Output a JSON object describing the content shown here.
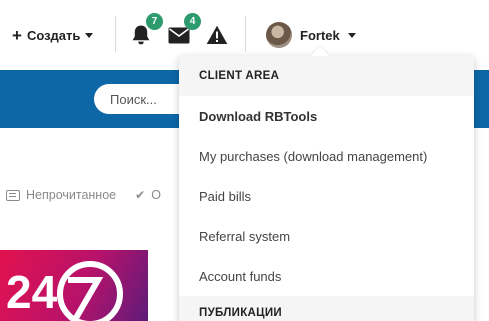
{
  "header": {
    "create_label": "Создать",
    "notifications_badge": "7",
    "messages_badge": "4",
    "user_name": "Fortek"
  },
  "search": {
    "placeholder": "Поиск..."
  },
  "subnav": {
    "unread_label": "Непрочитанное",
    "partial_label": "О"
  },
  "thumbnail": {
    "text": "24·7"
  },
  "dropdown": {
    "section_title": "CLIENT AREA",
    "items": [
      "Download RBTools",
      "My purchases (download management)",
      "Paid bills",
      "Referral system",
      "Account funds"
    ],
    "section2_title": "ПУБЛИКАЦИИ"
  },
  "colors": {
    "brand_blue": "#0d67a7",
    "badge_green": "#2e9b6e",
    "thumb_magenta": "#e2124f"
  }
}
